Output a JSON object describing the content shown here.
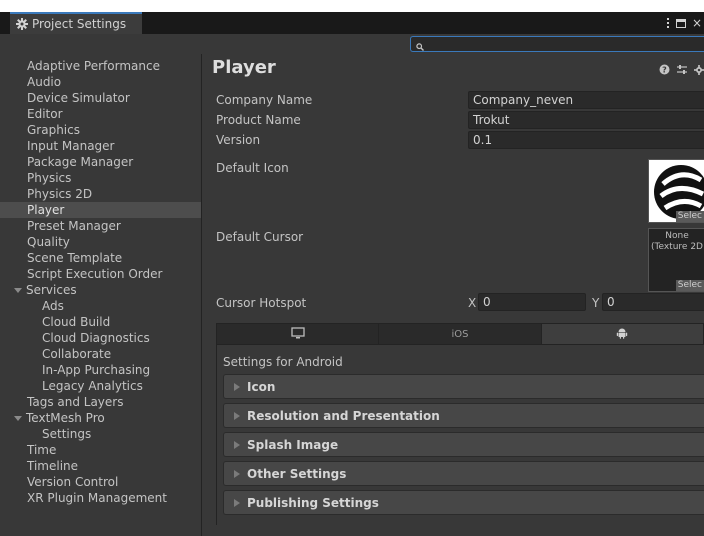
{
  "window": {
    "tab_title": "Project Settings",
    "tab_icon": "gear-icon",
    "close_glyph": "×"
  },
  "search": {
    "placeholder": ""
  },
  "sidebar": {
    "items": [
      {
        "label": "Adaptive Performance",
        "indent": 0
      },
      {
        "label": "Audio",
        "indent": 0
      },
      {
        "label": "Device Simulator",
        "indent": 0
      },
      {
        "label": "Editor",
        "indent": 0
      },
      {
        "label": "Graphics",
        "indent": 0
      },
      {
        "label": "Input Manager",
        "indent": 0
      },
      {
        "label": "Package Manager",
        "indent": 0
      },
      {
        "label": "Physics",
        "indent": 0
      },
      {
        "label": "Physics 2D",
        "indent": 0
      },
      {
        "label": "Player",
        "indent": 0,
        "selected": true
      },
      {
        "label": "Preset Manager",
        "indent": 0
      },
      {
        "label": "Quality",
        "indent": 0
      },
      {
        "label": "Scene Template",
        "indent": 0
      },
      {
        "label": "Script Execution Order",
        "indent": 0
      },
      {
        "label": "Services",
        "indent": 0,
        "foldout": true
      },
      {
        "label": "Ads",
        "indent": 1
      },
      {
        "label": "Cloud Build",
        "indent": 1
      },
      {
        "label": "Cloud Diagnostics",
        "indent": 1
      },
      {
        "label": "Collaborate",
        "indent": 1
      },
      {
        "label": "In-App Purchasing",
        "indent": 1
      },
      {
        "label": "Legacy Analytics",
        "indent": 1
      },
      {
        "label": "Tags and Layers",
        "indent": 0
      },
      {
        "label": "TextMesh Pro",
        "indent": 0,
        "foldout": true
      },
      {
        "label": "Settings",
        "indent": 1
      },
      {
        "label": "Time",
        "indent": 0
      },
      {
        "label": "Timeline",
        "indent": 0
      },
      {
        "label": "Version Control",
        "indent": 0
      },
      {
        "label": "XR Plugin Management",
        "indent": 0
      }
    ]
  },
  "player": {
    "title": "Player",
    "company_name_label": "Company Name",
    "company_name_value": "Company_neven",
    "product_name_label": "Product Name",
    "product_name_value": "Trokut",
    "version_label": "Version",
    "version_value": "0.1",
    "default_icon_label": "Default Icon",
    "icon_select_label": "Selec",
    "default_cursor_label": "Default Cursor",
    "cursor_none_text": "None",
    "cursor_type_text": "(Texture 2D",
    "cursor_select_label": "Selec",
    "cursor_hotspot_label": "Cursor Hotspot",
    "hotspot_x_label": "X",
    "hotspot_x_value": "0",
    "hotspot_y_label": "Y",
    "hotspot_y_value": "0",
    "platform_tabs": [
      {
        "label": "",
        "icon": "monitor-icon"
      },
      {
        "label": "iOS",
        "icon": ""
      },
      {
        "label": "",
        "icon": "android-icon",
        "active": true
      }
    ],
    "settings_for_label": "Settings for Android",
    "sections": [
      "Icon",
      "Resolution and Presentation",
      "Splash Image",
      "Other Settings",
      "Publishing Settings"
    ]
  },
  "colors": {
    "accent": "#3a79bb",
    "panel": "#383838",
    "field": "#2a2a2a",
    "selected": "#4d4d4d"
  }
}
